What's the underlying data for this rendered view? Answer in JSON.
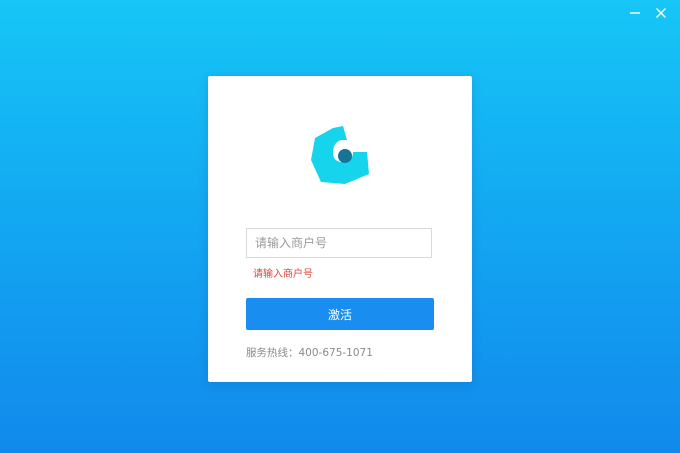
{
  "window": {
    "minimize_label": "—",
    "close_label": "✕"
  },
  "logo": {
    "icon": "brand-logo-icon",
    "color_outer": "#16d4ec",
    "color_inner": "#157595"
  },
  "form": {
    "merchant_input": {
      "placeholder": "请输入商户号",
      "value": ""
    },
    "error_message": "请输入商户号",
    "activate_label": "激活"
  },
  "footer": {
    "hotline_label": "服务热线：",
    "hotline_number": "400-675-1071"
  },
  "colors": {
    "background_top": "#16c6f6",
    "background_bottom": "#1189ec",
    "button": "#1a8ef0",
    "error": "#e0433a"
  }
}
